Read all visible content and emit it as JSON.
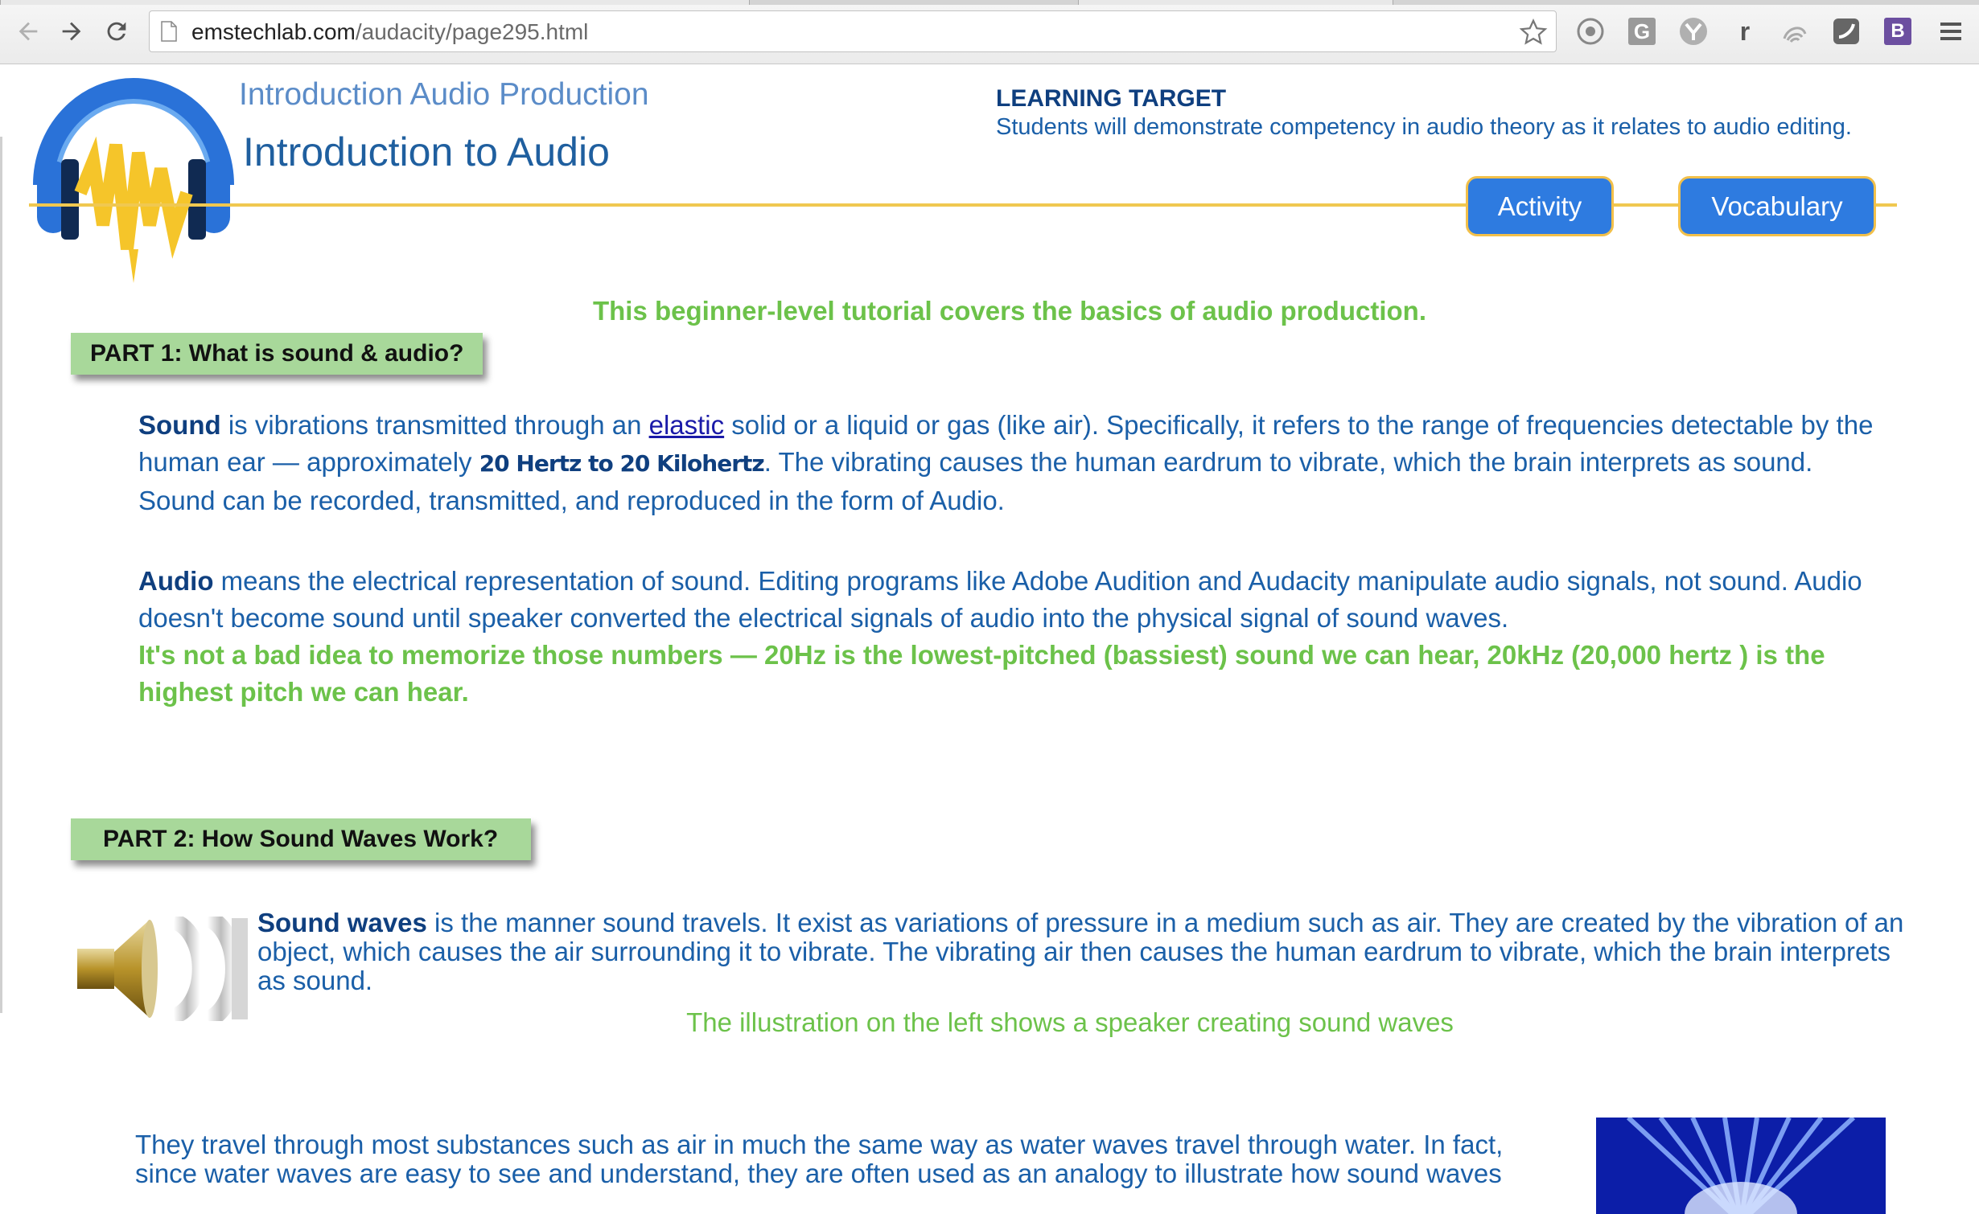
{
  "browser": {
    "url_domain": "emstechlab.com",
    "url_path": "/audacity/page295.html",
    "extensions": [
      "record-icon",
      "g-extension-icon",
      "y-extension-icon",
      "r-extension-icon",
      "swirl-extension-icon",
      "square-extension-icon",
      "b-extension-icon"
    ],
    "ext_letters": {
      "g": "G",
      "r": "r",
      "b": "B"
    }
  },
  "header": {
    "course_title": "Introduction Audio Production",
    "lesson_title": "Introduction to Audio",
    "learning_target_title": "LEARNING TARGET",
    "learning_target_text": "Students will demonstrate competency in audio theory as it relates to audio editing.",
    "activity_button": "Activity",
    "vocabulary_button": "Vocabulary"
  },
  "intro_text": "This beginner-level tutorial covers the basics of audio production.",
  "part1": {
    "label": "PART 1: What is sound & audio?",
    "sound_term": "Sound",
    "sound_text_a": " is vibrations transmitted through an ",
    "elastic_link": "elastic",
    "sound_text_b": " solid or a liquid or gas (like air).  Specifically, it refers to the range of frequencies detectable by the human ear — approximately ",
    "frequency_range": "20 Hertz to 20 Kilohertz",
    "sound_text_c": ".  The vibrating causes the human eardrum to vibrate, which the brain interprets as sound. Sound can be recorded, transmitted, and reproduced in the form of Audio.",
    "audio_term": "Audio",
    "audio_text": " means the electrical representation of sound. Editing programs like Adobe Audition and Audacity manipulate audio signals, not sound. Audio doesn't become sound until speaker converted the electrical signals of audio into the physical signal of sound waves.",
    "memorize_text": "It's not a bad idea to memorize those numbers — 20Hz is the lowest-pitched (bassiest) sound we can hear, 20kHz (20,000 hertz ) is the highest pitch we can hear."
  },
  "part2": {
    "label": "PART 2: How Sound Waves Work?",
    "sound_waves_term": "Sound waves",
    "sound_waves_text": " is the manner sound travels. It exist as variations of pressure in a medium such as air. They are created by the vibration of an object, which causes the air surrounding it to vibrate. The vibrating air then causes the human eardrum to vibrate, which the brain interprets as sound.",
    "caption": "The illustration on the left shows a speaker creating sound waves",
    "water_text": "They travel through most substances such as air in much the same way as water waves travel through water. In fact, since water waves are easy to see and understand, they are often used as an analogy to illustrate how sound waves"
  },
  "colors": {
    "accent_blue": "#2e7be0",
    "gold": "#f0c850",
    "green": "#6cc24a",
    "text_blue": "#1a5fa8",
    "label_green": "#a8d89a"
  }
}
